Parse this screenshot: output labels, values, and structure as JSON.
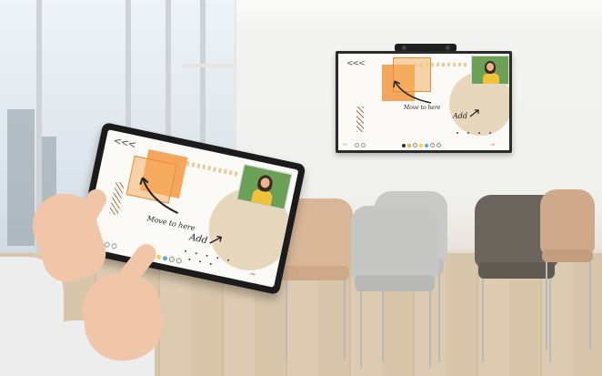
{
  "whiteboard": {
    "back_icon": "<<<",
    "move_note": "Move to here",
    "add_note": "Add",
    "toolbar_colors": [
      "#2b2b2b",
      "#f1a93c",
      "#e9e9e9",
      "#f4d24a",
      "#5aa7e8",
      "#c4c4c4",
      "#c4c4c4"
    ],
    "brand_mark": "TD"
  },
  "colors": {
    "accent_orange": "#f4a65a",
    "beige_circle": "#e7d7bd",
    "video_bg": "#6aa157",
    "bezel": "#1b1b1b"
  },
  "icons": [
    "back-arrow-icon",
    "pen-icon",
    "eraser-icon",
    "undo-icon",
    "camera-icon"
  ]
}
